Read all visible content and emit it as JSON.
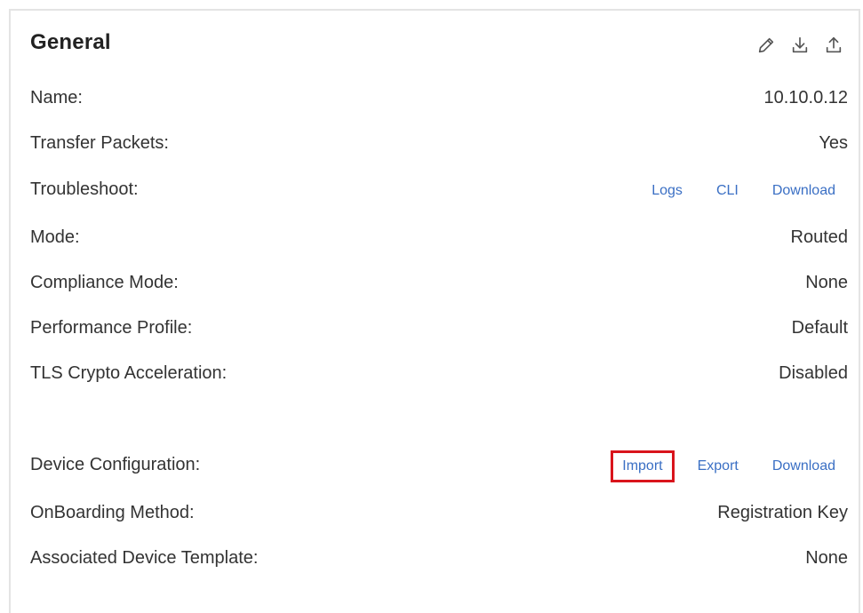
{
  "card": {
    "title": "General",
    "icons": [
      "pencil-icon",
      "download-icon",
      "upload-icon"
    ]
  },
  "rows": {
    "name": {
      "label": "Name:",
      "value": "10.10.0.12"
    },
    "transfer_packets": {
      "label": "Transfer Packets:",
      "value": "Yes"
    },
    "troubleshoot": {
      "label": "Troubleshoot:",
      "links": [
        "Logs",
        "CLI",
        "Download"
      ]
    },
    "mode": {
      "label": "Mode:",
      "value": "Routed"
    },
    "compliance_mode": {
      "label": "Compliance Mode:",
      "value": "None"
    },
    "performance_profile": {
      "label": "Performance Profile:",
      "value": "Default"
    },
    "tls_crypto": {
      "label": "TLS Crypto Acceleration:",
      "value": "Disabled"
    },
    "device_configuration": {
      "label": "Device Configuration:",
      "links": [
        "Import",
        "Export",
        "Download"
      ]
    },
    "onboarding_method": {
      "label": "OnBoarding Method:",
      "value": "Registration Key"
    },
    "associated_template": {
      "label": "Associated Device Template:",
      "value": "None"
    }
  },
  "colors": {
    "link": "#3a6fc4",
    "highlight_border": "#d9141c",
    "card_border": "#e4e4e4"
  }
}
